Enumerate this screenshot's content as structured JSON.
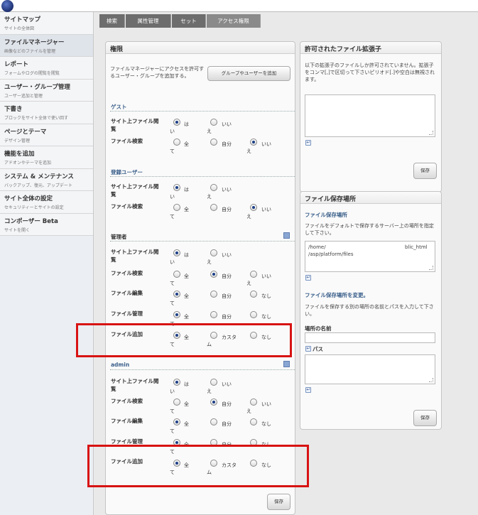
{
  "sidebar": {
    "items": [
      {
        "title": "サイトマップ",
        "sub": "サイトの全体図"
      },
      {
        "title": "ファイルマネージャー",
        "sub": "画像などのファイルを管理"
      },
      {
        "title": "レポート",
        "sub": "フォームやログの閲覧を閲覧"
      },
      {
        "title": "ユーザー・グループ管理",
        "sub": "ユーザー追加と管理"
      },
      {
        "title": "下書き",
        "sub": "ブロックをサイト全体で使い回す"
      },
      {
        "title": "ページとテーマ",
        "sub": "デザイン管理"
      },
      {
        "title": "機能を追加",
        "sub": "アドオンやテーマを追加"
      },
      {
        "title": "システム & メンテナンス",
        "sub": "バックアップ、復元、アップデート"
      },
      {
        "title": "サイト全体の設定",
        "sub": "セキュリティーとサイトの設定"
      },
      {
        "title": "コンポーザー Beta",
        "sub": "サイトを開く"
      }
    ]
  },
  "tabs": [
    "検索",
    "属性管理",
    "セット",
    "アクセス権限"
  ],
  "perm": {
    "title": "権限",
    "intro": "ファイルマネージャーにアクセスを許可するユーザー・グループを追加する。",
    "add_button": "グループやユーザーを追加",
    "save": "保存",
    "labels": {
      "view": "サイト上ファイル閲覧",
      "search": "ファイル検索",
      "edit": "ファイル編集",
      "manage": "ファイル管理",
      "add": "ファイル追加"
    },
    "opts": {
      "yes_a": "は",
      "yes_b": "い",
      "no_a": "いい",
      "no_b": "え",
      "all_a": "全",
      "all_b": "て",
      "self": "自分",
      "none": "なし",
      "custom_a": "カスタ",
      "custom_b": "ム"
    },
    "groups": {
      "guest": "ゲスト",
      "registered": "登録ユーザー",
      "admins": "管理者",
      "admin": "admin"
    }
  },
  "extensions": {
    "title": "許可されたファイル拡張子",
    "desc": "以下の拡張子のファイルしか許可されていません。拡張子をコンマ[,]で区切って下さいピリオド[.]や空白は無視されます。",
    "save": "保存"
  },
  "storage": {
    "title": "ファイル保存場所",
    "sub1": "ファイル保存場所",
    "desc1": "ファイルをデフォルトで保存するサーバー上の場所を指定して下さい。",
    "path_line1a": "/home/",
    "path_line1b": "blic_html",
    "path_line2": "/asp/platform/files",
    "sub2": "ファイル保存場所を変更。",
    "desc2": "ファイルを保存する別の場所の名前とパスを入力して下さい。",
    "name_label": "場所の名前",
    "path_label": "パス",
    "save": "保存"
  },
  "colors": {
    "highlight": "#d81313",
    "section": "#3a5f8a",
    "tab": "#6d6d6d"
  }
}
